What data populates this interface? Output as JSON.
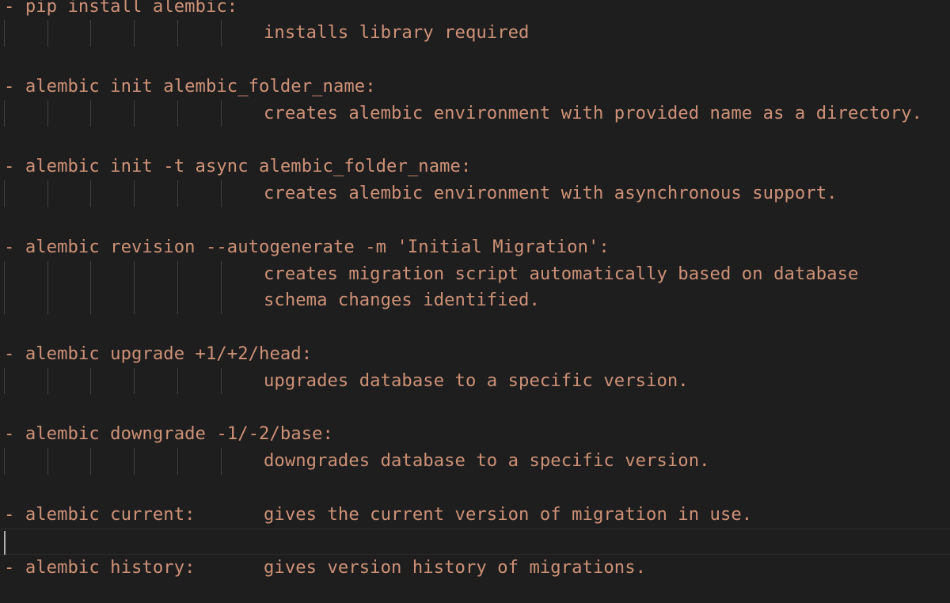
{
  "editor": {
    "lines": [
      {
        "text": "- pip install alembic:",
        "indent": false
      },
      {
        "text": "installs library required",
        "indent": true
      },
      {
        "text": "",
        "indent": false
      },
      {
        "text": "- alembic init alembic_folder_name:",
        "indent": false
      },
      {
        "text": "creates alembic environment with provided name as a directory.",
        "indent": true
      },
      {
        "text": "",
        "indent": false
      },
      {
        "text": "- alembic init -t async alembic_folder_name:",
        "indent": false
      },
      {
        "text": "creates alembic environment with asynchronous support.",
        "indent": true
      },
      {
        "text": "",
        "indent": false
      },
      {
        "text": "- alembic revision --autogenerate -m 'Initial Migration':",
        "indent": false
      },
      {
        "text": "creates migration script automatically based on database",
        "indent": true
      },
      {
        "text": "schema changes identified.",
        "indent": true
      },
      {
        "text": "",
        "indent": false
      },
      {
        "text": "- alembic upgrade +1/+2/head:",
        "indent": false
      },
      {
        "text": "upgrades database to a specific version.",
        "indent": true
      },
      {
        "text": "",
        "indent": false
      },
      {
        "text": "- alembic downgrade -1/-2/base:",
        "indent": false
      },
      {
        "text": "downgrades database to a specific version.",
        "indent": true
      },
      {
        "text": "",
        "indent": false
      },
      {
        "text": "- alembic current:",
        "indent": false,
        "description": "gives the current version of migration in use."
      },
      {
        "text": "",
        "indent": false,
        "current": true
      },
      {
        "text": "- alembic history:",
        "indent": false,
        "description": "gives version history of migrations."
      }
    ]
  },
  "colors": {
    "background": "#1e1e1e",
    "text": "#ce9178",
    "indent_guide": "#404040",
    "cursor": "#aeafad"
  }
}
